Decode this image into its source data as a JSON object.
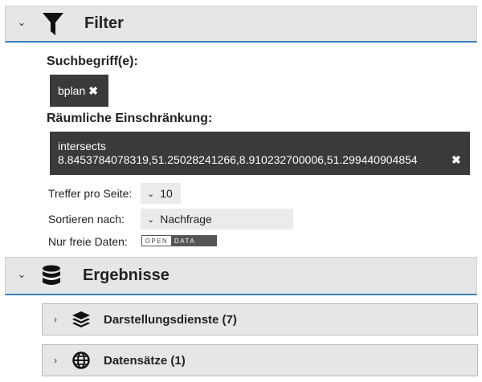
{
  "filter": {
    "title": "Filter",
    "search_label": "Suchbegriff(e):",
    "search_term": "bplan",
    "spatial_label": "Räumliche Einschränkung:",
    "spatial_line1": "intersects",
    "spatial_line2": "8.8453784078319,51.25028241266,8.910232700006,51.299440904854",
    "remove_glyph": "✖",
    "hits_label": "Treffer pro Seite:",
    "hits_value": "10",
    "sort_label": "Sortieren nach:",
    "sort_value": "Nachfrage",
    "free_label": "Nur freie Daten:",
    "opendata_open": "OPEN",
    "opendata_data": "DATA"
  },
  "results": {
    "title": "Ergebnisse",
    "panels": [
      {
        "label": "Darstellungsdienste (7)",
        "icon": "layers-icon"
      },
      {
        "label": "Datensätze (1)",
        "icon": "globe-icon"
      }
    ]
  },
  "icons": {
    "collapse": "chevron-down-icon",
    "expand": "chevron-right-icon",
    "filter": "funnel-icon",
    "results": "database-icon"
  },
  "colors": {
    "header_bg": "#e6e6e6",
    "accent": "#3a7ebf",
    "chip_bg": "#3a3a3a"
  }
}
